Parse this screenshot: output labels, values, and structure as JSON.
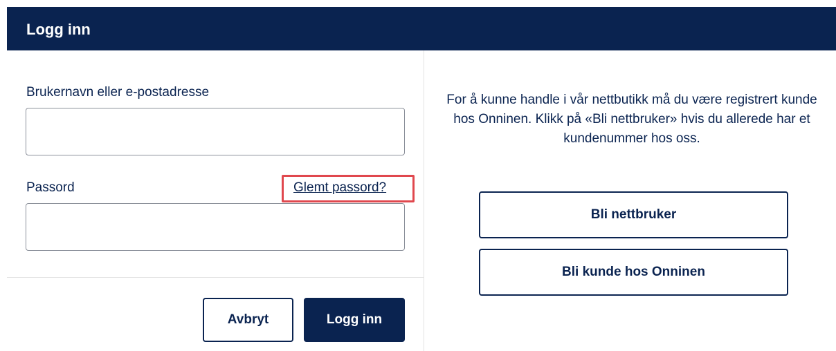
{
  "header": {
    "title": "Logg inn"
  },
  "login_form": {
    "username_label": "Brukernavn eller e-postadresse",
    "username_value": "",
    "password_label": "Passord",
    "password_value": "",
    "forgot_link": "Glemt passord?",
    "cancel_label": "Avbryt",
    "submit_label": "Logg inn"
  },
  "info_panel": {
    "text": "For å kunne handle i vår nettbutikk må du være registrert kunde hos Onninen. Klikk på «Bli nettbruker» hvis du allerede har et kundenummer hos oss.",
    "register_label": "Bli nettbruker",
    "become_customer_label": "Bli kunde hos Onninen"
  },
  "colors": {
    "brand_navy": "#0a2350",
    "highlight_red": "#e0484e",
    "border_gray": "#8a8f99"
  }
}
